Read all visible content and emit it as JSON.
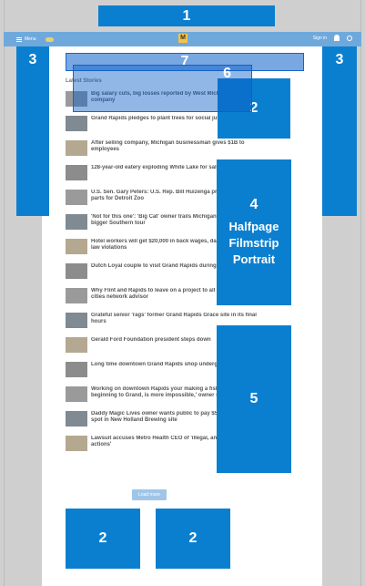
{
  "topbar": {
    "menu_label": "Menu",
    "weather": "",
    "site_name": "",
    "logo_letter": "M",
    "signin_label": "Sign in"
  },
  "ads": {
    "top": "1",
    "left": "3",
    "right": "3",
    "r2": "2",
    "r4_num": "4",
    "r4_line1": "Halfpage",
    "r4_line2": "Filmstrip",
    "r4_line3": "Portrait",
    "r5": "5",
    "b2a": "2",
    "b2b": "2",
    "overlay6": "6",
    "overlay7": "7"
  },
  "section": {
    "title": "Latest Stories"
  },
  "news": [
    {
      "headline": "Big salary cuts, big losses reported by West Michigan nonprofits company",
      "meta": ""
    },
    {
      "headline": "Grand Rapids pledges to plant trees for social justice",
      "meta": ""
    },
    {
      "headline": "After selling company, Michigan businessman gives $1B to employees",
      "meta": ""
    },
    {
      "headline": "128-year-old eatery exploding White Lake for sale for years",
      "meta": ""
    },
    {
      "headline": "U.S. Sen. Gary Peters: U.S. Rep. Bill Huizenga promote fresh parts for Detroit Zoo",
      "meta": ""
    },
    {
      "headline": "'Not for this one': 'Big Cat' owner trails Michigan zoo for tech on a bigger Southern tour",
      "meta": ""
    },
    {
      "headline": "Hotel workers will get $20,000 in back wages, damages for labor law violations",
      "meta": ""
    },
    {
      "headline": "Dutch Loyal couple to visit Grand Rapids during far trip to U.S.",
      "meta": ""
    },
    {
      "headline": "Why Flint and Rapids to leave on a project to all learn more in-cities network advisor",
      "meta": ""
    },
    {
      "headline": "Grateful senior 'rags' former Grand Rapids Grace site in its final hours",
      "meta": ""
    },
    {
      "headline": "Gerald Ford Foundation president steps down",
      "meta": ""
    },
    {
      "headline": "Long time downtown Grand Rapids shop undergoing makeover",
      "meta": ""
    },
    {
      "headline": "Working on downtown Rapids your making a fishing 'boats beginning to Grand, is more impossible,' owner says",
      "meta": ""
    },
    {
      "headline": "Daddy Magic Lives owner wants public to pay $500K for dance spot in New Holland Brewing site",
      "meta": ""
    },
    {
      "headline": "Lawsuit accuses Metro Health CEO of 'illegal, and confidential actions'",
      "meta": ""
    }
  ],
  "load_more": "Load more"
}
